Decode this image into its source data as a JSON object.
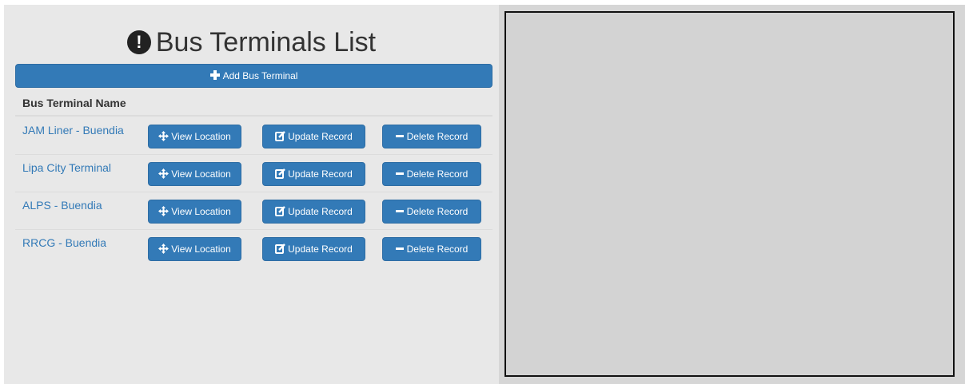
{
  "page": {
    "title": "Bus Terminals List",
    "title_icon": "exclamation-sign-icon"
  },
  "toolbar": {
    "add_label": "Add Bus Terminal",
    "add_icon": "plus-icon"
  },
  "table": {
    "header": "Bus Terminal Name",
    "rows": [
      {
        "name": "JAM Liner - Buendia",
        "view": "View Location",
        "update": "Update Record",
        "delete": "Delete Record"
      },
      {
        "name": "Lipa City Terminal",
        "view": "View Location",
        "update": "Update Record",
        "delete": "Delete Record"
      },
      {
        "name": "ALPS - Buendia",
        "view": "View Location",
        "update": "Update Record",
        "delete": "Delete Record"
      },
      {
        "name": "RRCG - Buendia",
        "view": "View Location",
        "update": "Update Record",
        "delete": "Delete Record"
      }
    ]
  },
  "colors": {
    "primary": "#337ab7",
    "panel_bg": "#e8e8e8",
    "map_bg": "#d3d3d3"
  }
}
